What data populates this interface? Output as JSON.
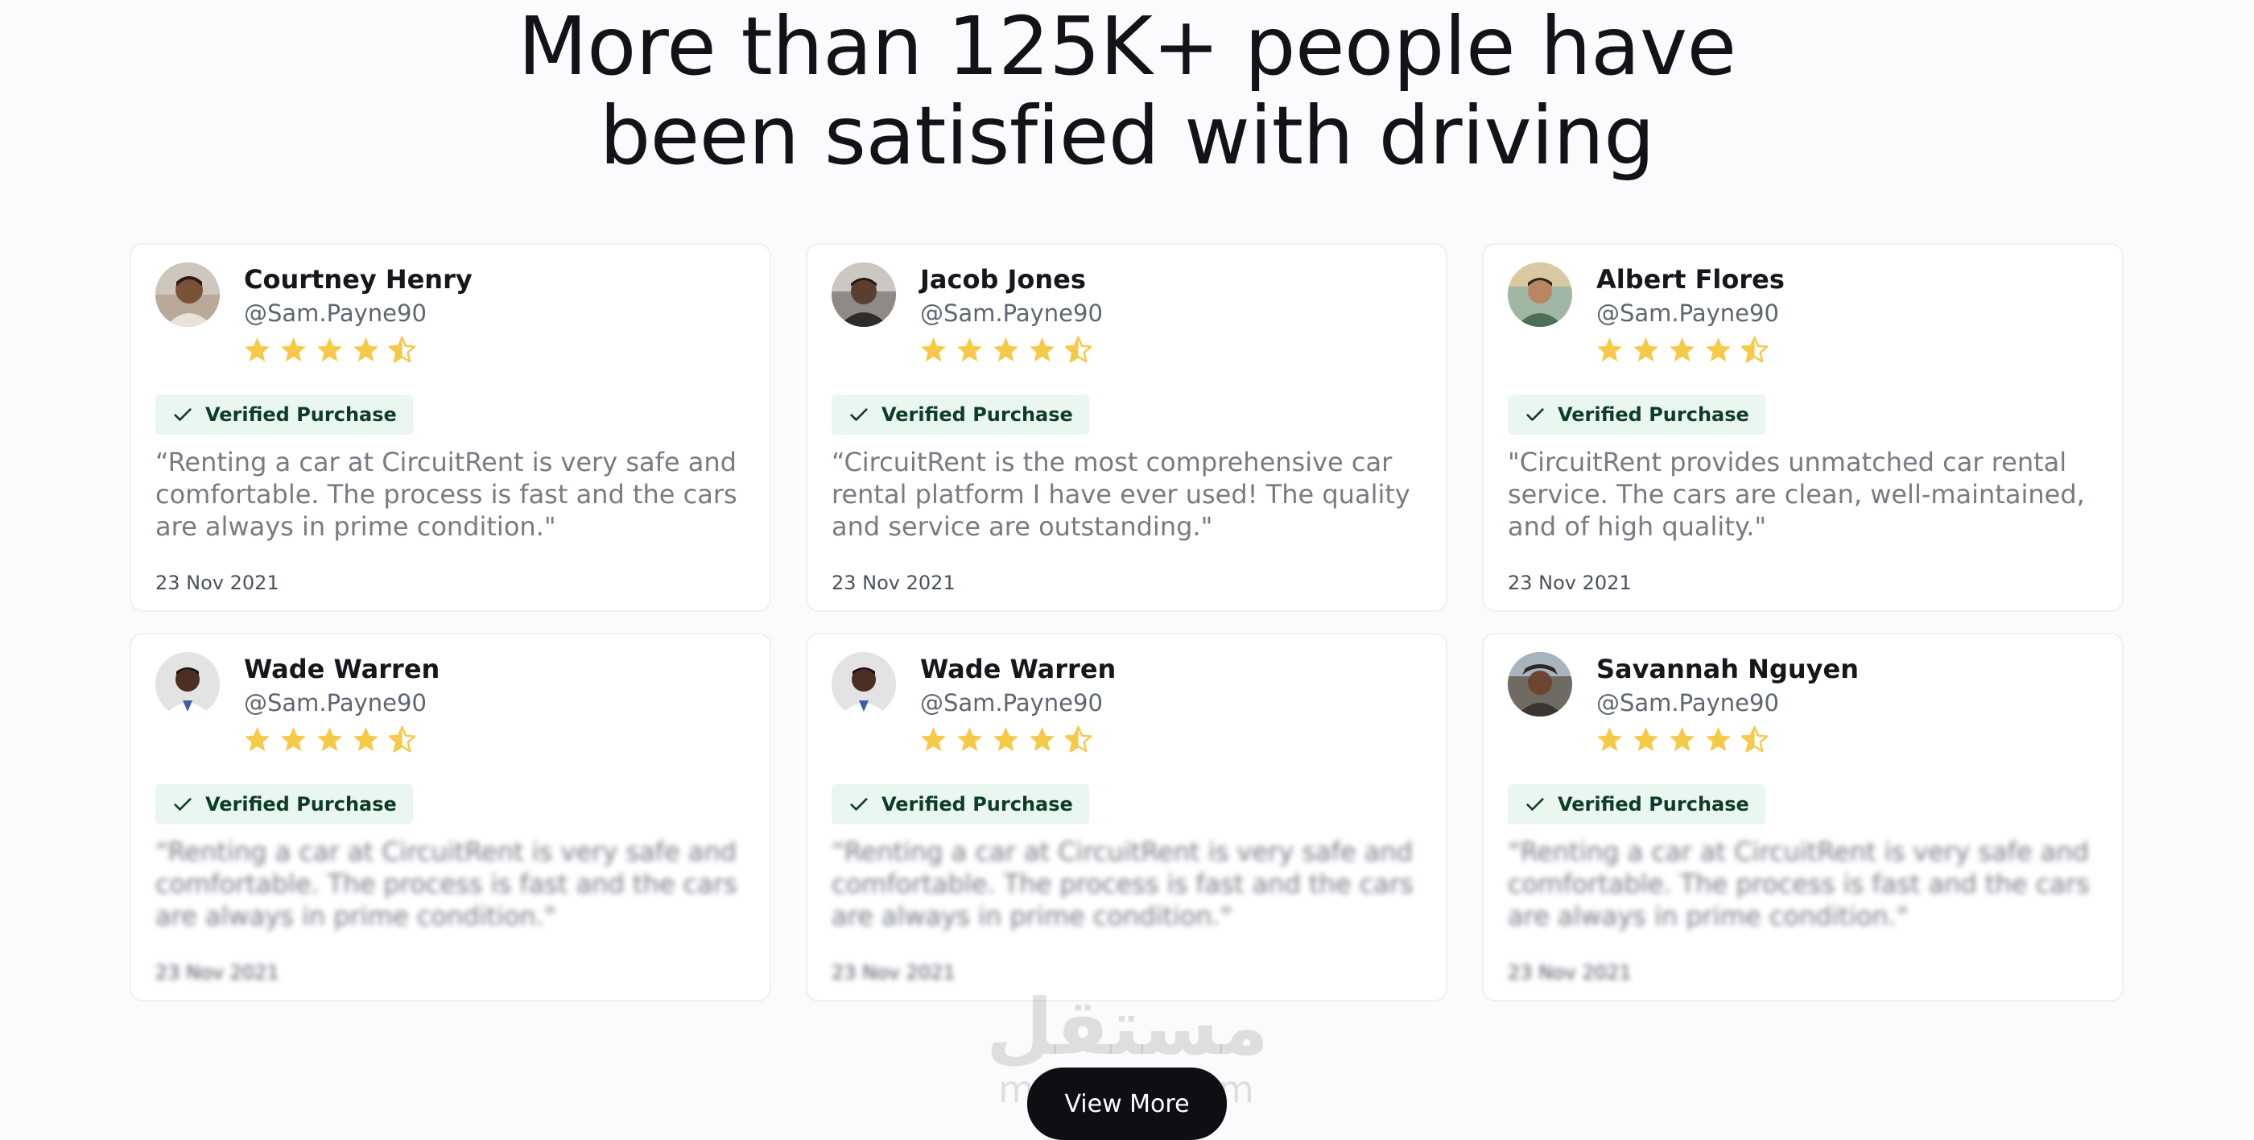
{
  "header": {
    "title_line1": "More than 125K+ people have",
    "title_line2": "been satisfied with driving"
  },
  "colors": {
    "star": "#f7c948",
    "badge_bg": "#e9f7f0",
    "badge_text": "#0f3c28",
    "button_bg": "#0e0f12"
  },
  "reviews": [
    {
      "name": "Courtney Henry",
      "handle": "@Sam.Payne90",
      "rating": 4.5,
      "badge": "Verified Purchase",
      "text": "“Renting a car at CircuitRent is very safe and comfortable. The process is fast and the cars are always in prime condition.\"",
      "date": "23 Nov 2021",
      "avatar_icon": "avatar-photo"
    },
    {
      "name": "Jacob Jones",
      "handle": "@Sam.Payne90",
      "rating": 4.5,
      "badge": "Verified Purchase",
      "text": "“CircuitRent is the most comprehensive car rental platform I have ever used! The quality and service are outstanding.\"",
      "date": "23 Nov 2021",
      "avatar_icon": "avatar-photo"
    },
    {
      "name": "Albert Flores",
      "handle": "@Sam.Payne90",
      "rating": 4.5,
      "badge": "Verified Purchase",
      "text": "\"CircuitRent provides unmatched car rental service. The cars are clean, well-maintained, and of high quality.\"",
      "date": "23 Nov 2021",
      "avatar_icon": "avatar-photo"
    },
    {
      "name": "Wade Warren",
      "handle": "@Sam.Payne90",
      "rating": 4.5,
      "badge": "Verified Purchase",
      "text": "“Renting a car at CircuitRent is very safe and comfortable. The process is fast and the cars are always in prime condition.\"",
      "date": "23 Nov 2021",
      "avatar_icon": "avatar-photo"
    },
    {
      "name": "Wade Warren",
      "handle": "@Sam.Payne90",
      "rating": 4.5,
      "badge": "Verified Purchase",
      "text": "“Renting a car at CircuitRent is very safe and comfortable. The process is fast and the cars are always in prime condition.\"",
      "date": "23 Nov 2021",
      "avatar_icon": "avatar-photo"
    },
    {
      "name": "Savannah Nguyen",
      "handle": "@Sam.Payne90",
      "rating": 4.5,
      "badge": "Verified Purchase",
      "text": "“Renting a car at CircuitRent is very safe and comfortable. The process is fast and the cars are always in prime condition.\"",
      "date": "23 Nov 2021",
      "avatar_icon": "avatar-photo"
    }
  ],
  "cta": {
    "view_more_label": "View More"
  },
  "watermark": {
    "glyph": "مستقل",
    "text": "mostaql.com"
  }
}
